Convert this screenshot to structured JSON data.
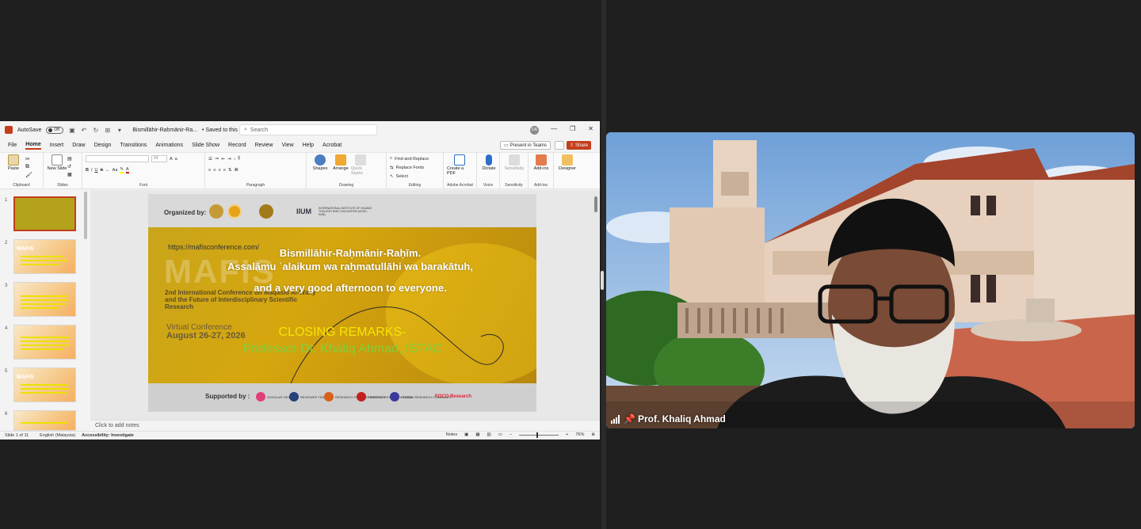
{
  "ppt": {
    "autosave_label": "AutoSave",
    "autosave_state": "Off",
    "doc_title": "Bismillāhir-Raḥmānir-Ra...",
    "saved_status": "Saved to this PC",
    "search_placeholder": "Search",
    "avatar_initials": "DA",
    "menu": [
      "File",
      "Home",
      "Insert",
      "Draw",
      "Design",
      "Transitions",
      "Animations",
      "Slide Show",
      "Record",
      "Review",
      "View",
      "Help",
      "Acrobat"
    ],
    "present_label": "Present in Teams",
    "share_label": "Share",
    "ribbon": {
      "paste": "Paste",
      "clipboard": "Clipboard",
      "new_slide": "New Slide",
      "slides": "Slides",
      "font_size": "54",
      "font": "Font",
      "paragraph": "Paragraph",
      "shapes": "Shapes",
      "arrange": "Arrange",
      "quick_styles": "Quick Styles",
      "drawing": "Drawing",
      "find_replace": "Find and Replace",
      "replace_fonts": "Replace Fonts",
      "select": "Select",
      "editing": "Editing",
      "create_pdf": "Create a PDF",
      "adobe_acrobat": "Adobe Acrobat",
      "dictate": "Dictate",
      "voice": "Voice",
      "sensitivity": "Sensitivity",
      "add_ins": "Add-ins",
      "designer": "Designer"
    },
    "thumb_numbers": [
      "1",
      "2",
      "3",
      "4",
      "5",
      "6"
    ],
    "thumb_title": "MAFIS",
    "notes_placeholder": "Click to add notes",
    "status": {
      "slide_of": "Slide 1 of 11",
      "language": "English (Malaysia)",
      "accessibility": "Accessibility: Investigate",
      "notes": "Notes",
      "zoom": "76%"
    }
  },
  "slide": {
    "organized_by": "Organized by:",
    "iium": "IIUM",
    "iium_sub": "INTERNATIONAL INSTITUTE OF ISLAMIC THOUGHT AND CIVILISATION (ISTAC-IIUM)",
    "url": "https://mafisconference.com/",
    "watermark": "MAFIS",
    "conference": "2nd International Conference on Maqasid Al-Wahy and the Future of Interdisciplinary Scientific Research",
    "virtual": "Virtual Conference",
    "dates": "August 26-27, 2026",
    "greeting_1": "Bismillāhir-Raḥmānir-Raḥīm.",
    "greeting_2": "Assalāmu ʿalaikum wa raḥmatullāhi wa barakātuh,",
    "greeting_3": "and a very good afternoon to everyone.",
    "closing_1": "CLOSING REMARKS-",
    "closing_2": "Professor Dr. Khaliq Ahmad, ISTAC",
    "supported_by": "Supported by :",
    "sponsors": [
      "SCHOLAR VIEW",
      "REVIEWER TRACK",
      "RESEARCH SYNERGY INSTITUTE",
      "RESEARCH SYNERGY PRESS",
      "GLOBAL RESEARCH COMMUNITY",
      "FOCO Research"
    ]
  },
  "video": {
    "participant_name": "Prof. Khaliq Ahmad"
  },
  "colors": {
    "accent": "#c43e1c",
    "closing_1": "#f5e600",
    "closing_2": "#7fd13b"
  }
}
